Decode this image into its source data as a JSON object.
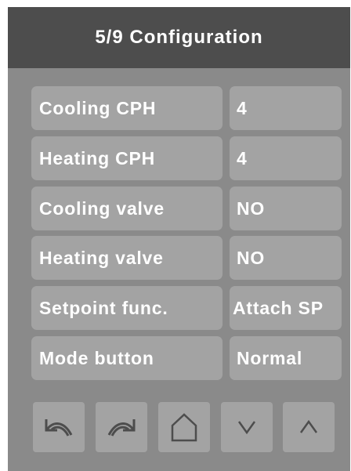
{
  "header": {
    "title": "5/9 Configuration"
  },
  "rows": [
    {
      "label": "Cooling CPH",
      "value": "4"
    },
    {
      "label": "Heating CPH",
      "value": "4"
    },
    {
      "label": "Cooling valve",
      "value": "NO"
    },
    {
      "label": "Heating valve",
      "value": "NO"
    },
    {
      "label": "Setpoint func.",
      "value": "Attach SP"
    },
    {
      "label": "Mode button",
      "value": "Normal"
    }
  ],
  "nav_buttons": [
    {
      "name": "back",
      "icon": "undo-arrow-icon"
    },
    {
      "name": "forward",
      "icon": "redo-arrow-icon"
    },
    {
      "name": "home",
      "icon": "home-icon"
    },
    {
      "name": "down",
      "icon": "chevron-down-icon"
    },
    {
      "name": "up",
      "icon": "chevron-up-icon"
    }
  ],
  "colors": {
    "header_bg": "#4d4d4d",
    "panel_bg": "#8a8a8a",
    "cell_bg": "#a3a3a3",
    "text": "#ffffff",
    "icon": "#4d4d4d"
  }
}
